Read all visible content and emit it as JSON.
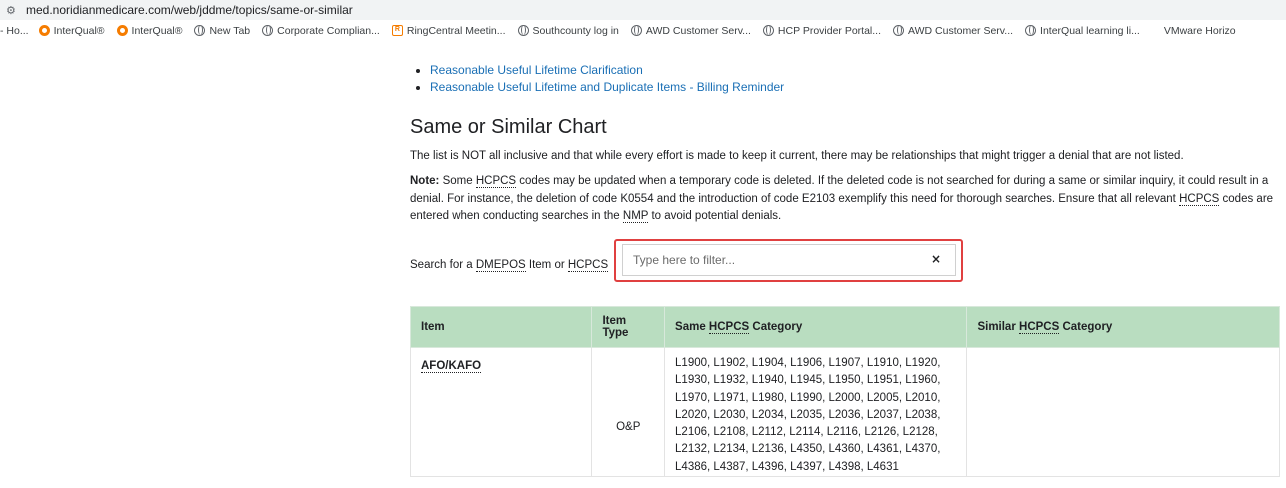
{
  "browser": {
    "url": "med.noridianmedicare.com/web/jddme/topics/same-or-similar",
    "bookmarks": [
      {
        "label": "- Ho...",
        "icon": "none"
      },
      {
        "label": "InterQual®",
        "icon": "interqual-icon"
      },
      {
        "label": "InterQual®",
        "icon": "interqual-icon"
      },
      {
        "label": "New Tab",
        "icon": "globe-icon"
      },
      {
        "label": "Corporate Complian...",
        "icon": "globe-icon"
      },
      {
        "label": "RingCentral Meetin...",
        "icon": "ringcentral-icon"
      },
      {
        "label": "Southcounty log in",
        "icon": "globe-icon"
      },
      {
        "label": "AWD Customer Serv...",
        "icon": "globe-icon"
      },
      {
        "label": "HCP Provider Portal...",
        "icon": "globe-icon"
      },
      {
        "label": "AWD Customer Serv...",
        "icon": "globe-icon"
      },
      {
        "label": "InterQual learning li...",
        "icon": "globe-icon"
      },
      {
        "label": "VMware Horizo",
        "icon": "none"
      }
    ]
  },
  "page": {
    "links": [
      "Reasonable Useful Lifetime Clarification",
      "Reasonable Useful Lifetime and Duplicate Items - Billing Reminder"
    ],
    "heading": "Same or Similar Chart",
    "intro": "The list is NOT all inclusive and that while every effort is made to keep it current, there may be relationships that might trigger a denial that are not listed.",
    "note_label": "Note:",
    "note_text_1": " Some ",
    "note_abbr_1": "HCPCS",
    "note_text_2": " codes may be updated when a temporary code is deleted. If the deleted code is not searched for during a same or similar inquiry, it could result in a denial. For instance, the deletion of code K0554 and the introduction of code E2103 exemplify this need for thorough searches. Ensure that all relevant ",
    "note_abbr_2": "HCPCS",
    "note_text_3": " codes are entered when conducting searches in the ",
    "note_abbr_3": "NMP",
    "note_text_4": " to avoid potential denials.",
    "search_label_1": "Search for a ",
    "search_abbr_1": "DMEPOS",
    "search_label_2": " Item or ",
    "search_abbr_2": "HCPCS",
    "search_placeholder": "Type here to filter...",
    "clear_glyph": "×"
  },
  "table": {
    "headers": {
      "item": "Item",
      "item_type": "Item Type",
      "same_prefix": "Same ",
      "same_abbr": "HCPCS",
      "same_suffix": " Category",
      "similar_prefix": "Similar ",
      "similar_abbr": "HCPCS",
      "similar_suffix": " Category"
    },
    "rows": [
      {
        "item": "AFO/KAFO",
        "item_type": "O&P",
        "same_lines": [
          "L1900, L1902, L1904, L1906, L1907, L1910, L1920,",
          "L1930, L1932, L1940, L1945, L1950, L1951, L1960,",
          "L1970, L1971, L1980, L1990, L2000, L2005, L2010,",
          "L2020, L2030, L2034, L2035, L2036, L2037, L2038,",
          "L2106, L2108, L2112, L2114, L2116, L2126, L2128,",
          "L2132, L2134, L2136, L4350, L4360, L4361, L4370,",
          "L4386, L4387, L4396, L4397, L4398, L4631"
        ],
        "similar": ""
      }
    ]
  }
}
